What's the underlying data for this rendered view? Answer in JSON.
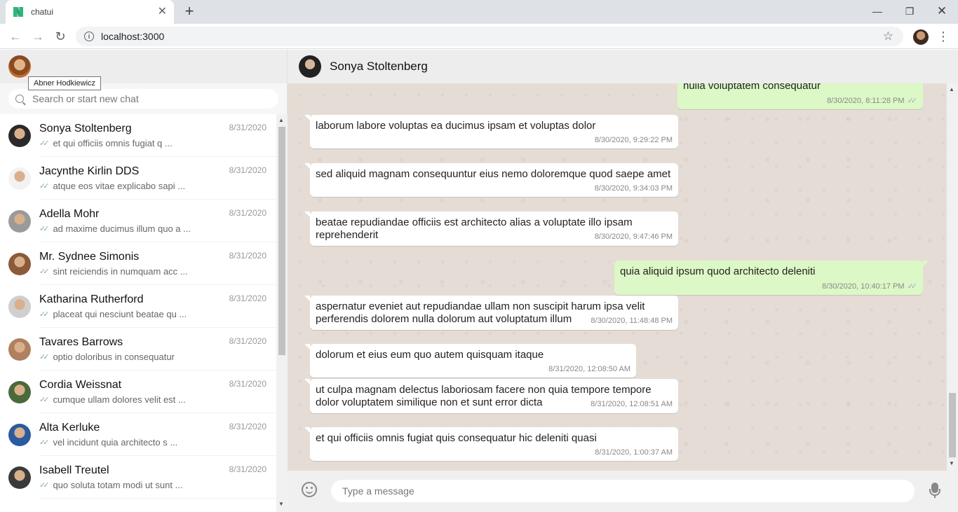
{
  "browser": {
    "tab_title": "chatui",
    "url": "localhost:3000"
  },
  "sidebar": {
    "me_tooltip": "Abner Hodkiewicz",
    "search_placeholder": "Search or start new chat",
    "chats": [
      {
        "name": "Sonya Stoltenberg",
        "date": "8/31/2020",
        "preview": "et qui officiis omnis fugiat q ...",
        "avatar": "#2a2a2a"
      },
      {
        "name": "Jacynthe Kirlin DDS",
        "date": "8/31/2020",
        "preview": "atque eos vitae explicabo sapi ...",
        "avatar": "#f2f2f2"
      },
      {
        "name": "Adella Mohr",
        "date": "8/31/2020",
        "preview": "ad maxime ducimus illum quo a ...",
        "avatar": "#9a9a9a"
      },
      {
        "name": "Mr. Sydnee Simonis",
        "date": "8/31/2020",
        "preview": "sint reiciendis in numquam acc ...",
        "avatar": "#8a5a3a"
      },
      {
        "name": "Katharina Rutherford",
        "date": "8/31/2020",
        "preview": "placeat qui nesciunt beatae qu ...",
        "avatar": "#cfcfcf"
      },
      {
        "name": "Tavares Barrows",
        "date": "8/31/2020",
        "preview": "optio doloribus in consequatur",
        "avatar": "#b08060"
      },
      {
        "name": "Cordia Weissnat",
        "date": "8/31/2020",
        "preview": "cumque ullam dolores velit est ...",
        "avatar": "#4a6a3a"
      },
      {
        "name": "Alta Kerluke",
        "date": "8/31/2020",
        "preview": "vel incidunt quia architecto s ...",
        "avatar": "#2a5aa0"
      },
      {
        "name": "Isabell Treutel",
        "date": "8/31/2020",
        "preview": "quo soluta totam modi ut sunt ...",
        "avatar": "#3a3a3a"
      }
    ]
  },
  "conversation": {
    "contact_name": "Sonya Stoltenberg",
    "input_placeholder": "Type a message",
    "messages": [
      {
        "dir": "out",
        "text": "nulla voluptatem consequatur",
        "time": "8/30/2020, 8:11:28 PM"
      },
      {
        "dir": "in",
        "text": "laborum labore voluptas ea ducimus ipsam et voluptas dolor",
        "time": "8/30/2020, 9:29:22 PM"
      },
      {
        "dir": "in",
        "text": "sed aliquid magnam consequuntur eius nemo doloremque quod saepe amet",
        "time": "8/30/2020, 9:34:03 PM"
      },
      {
        "dir": "in",
        "text": "beatae repudiandae officiis est architecto alias a voluptate illo ipsam reprehenderit",
        "time": "8/30/2020, 9:47:46 PM"
      },
      {
        "dir": "out",
        "text": "quia aliquid ipsum quod architecto deleniti",
        "time": "8/30/2020, 10:40:17 PM"
      },
      {
        "dir": "in",
        "text": "aspernatur eveniet aut repudiandae ullam non suscipit harum ipsa velit perferendis dolorem nulla dolorum aut voluptatum illum",
        "time": "8/30/2020, 11:48:48 PM"
      },
      {
        "dir": "in",
        "text": "dolorum et eius eum quo autem quisquam itaque",
        "time": "8/31/2020, 12:08:50 AM"
      },
      {
        "dir": "in",
        "text": "ut culpa magnam delectus laboriosam facere non quia tempore tempore dolor voluptatem similique non et sunt error dicta",
        "time": "8/31/2020, 12:08:51 AM"
      },
      {
        "dir": "in",
        "text": "et qui officiis omnis fugiat quis consequatur hic deleniti quasi",
        "time": "8/31/2020, 1:00:37 AM"
      }
    ]
  }
}
